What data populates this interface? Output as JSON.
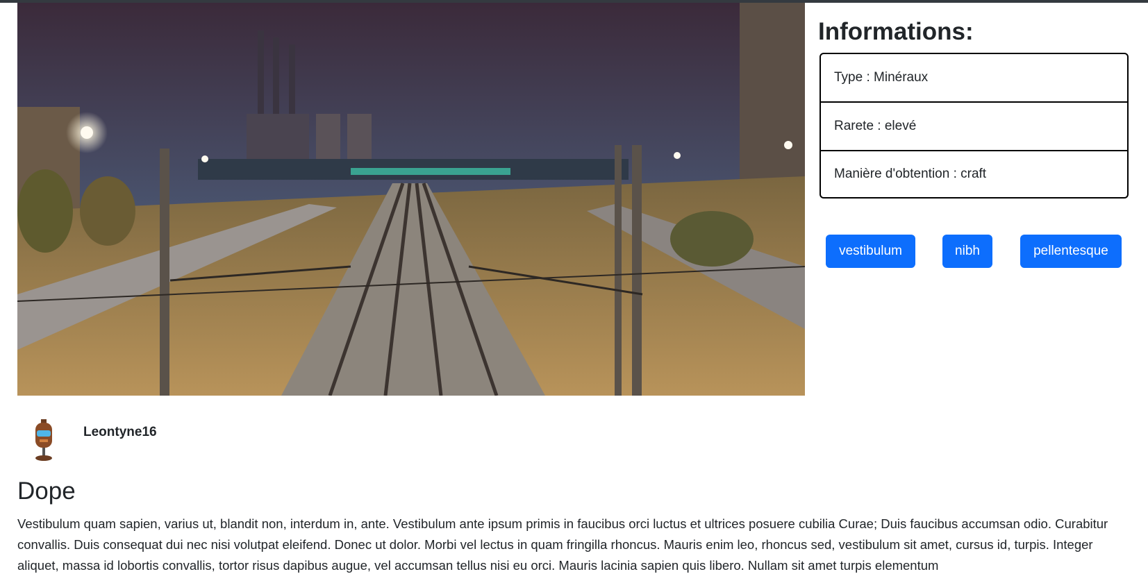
{
  "hero": {
    "alt": "Night view of railway tracks with city lights and industrial chimneys"
  },
  "info": {
    "title": "Informations:",
    "items": [
      {
        "label": "Type : Minéraux"
      },
      {
        "label": "Rarete : elevé"
      },
      {
        "label": "Manière d'obtention : craft"
      }
    ]
  },
  "tags": [
    "vestibulum",
    "nibh",
    "pellentesque"
  ],
  "author": {
    "name": "Leontyne16"
  },
  "post": {
    "title": "Dope",
    "body": "Vestibulum quam sapien, varius ut, blandit non, interdum in, ante. Vestibulum ante ipsum primis in faucibus orci luctus et ultrices posuere cubilia Curae; Duis faucibus accumsan odio. Curabitur convallis. Duis consequat dui nec nisi volutpat eleifend. Donec ut dolor. Morbi vel lectus in quam fringilla rhoncus. Mauris enim leo, rhoncus sed, vestibulum sit amet, cursus id, turpis. Integer aliquet, massa id lobortis convallis, tortor risus dapibus augue, vel accumsan tellus nisi eu orci. Mauris lacinia sapien quis libero. Nullam sit amet turpis elementum"
  },
  "colors": {
    "primary": "#0d6efd",
    "topbar": "#343a40",
    "text": "#212529"
  }
}
